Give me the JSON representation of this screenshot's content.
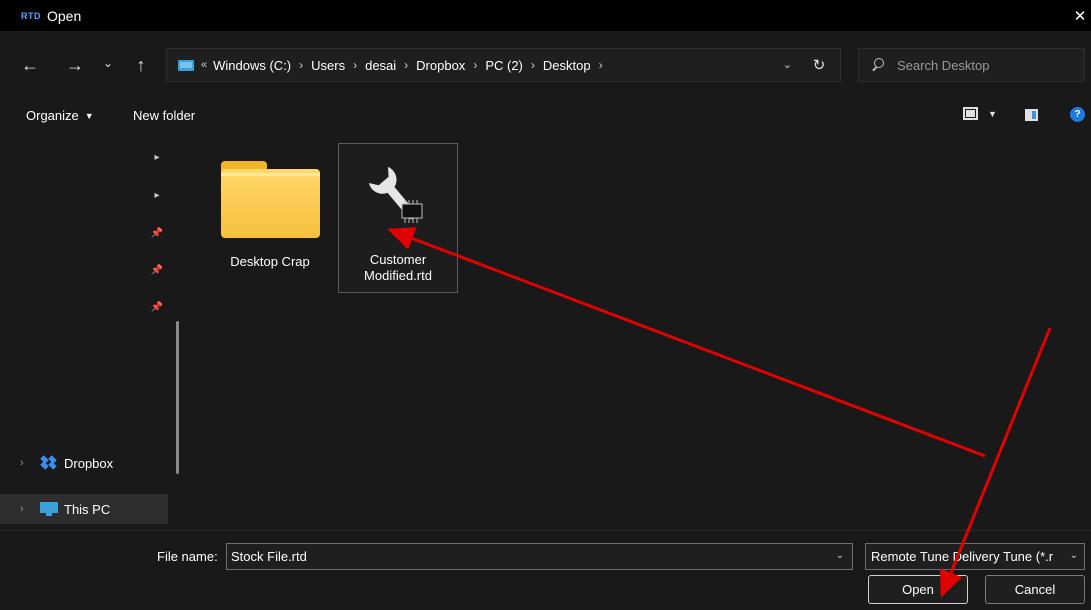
{
  "window": {
    "app_logo": "RTD",
    "title": "Open",
    "close_glyph": "✕"
  },
  "nav": {
    "back_glyph": "←",
    "forward_glyph": "→",
    "recent_glyph": "⌄",
    "up_glyph": "↑",
    "overflow_glyph": "«",
    "breadcrumb": [
      "Windows (C:)",
      "Users",
      "desai",
      "Dropbox",
      "PC (2)",
      "Desktop"
    ],
    "crumb_separator": "›",
    "dropdown_glyph": "⌄",
    "refresh_glyph": "↻",
    "search_placeholder": "Search Desktop"
  },
  "toolbar": {
    "organize_label": "Organize",
    "organize_caret": "▼",
    "new_folder_label": "New folder",
    "view_caret": "▼",
    "help_glyph": "?"
  },
  "sidebar": {
    "pins": [
      "▸",
      "▸",
      "📌",
      "📌",
      "📌"
    ],
    "items": [
      {
        "label": "Dropbox",
        "expand": "›",
        "icon": "dropbox-icon"
      },
      {
        "label": "This PC",
        "expand": "›",
        "icon": "pc-icon"
      }
    ]
  },
  "files": [
    {
      "name": "Desktop Crap",
      "icon": "folder-icon",
      "selected": false
    },
    {
      "name": "Customer Modified.rtd",
      "line1": "Customer",
      "line2": "Modified.rtd",
      "icon": "tune-file-icon",
      "selected": true
    }
  ],
  "bottom": {
    "file_name_label": "File name:",
    "file_name_value": "Stock File.rtd",
    "file_name_caret": "⌄",
    "filter_value": "Remote Tune Delivery Tune (*.r",
    "filter_caret": "⌄",
    "open_label": "Open",
    "cancel_label": "Cancel"
  },
  "colors": {
    "background": "#191919",
    "titlebar": "#000000",
    "annotation_arrow": "#e00000",
    "folder": "#f6c03d",
    "accent": "#1f7ae0"
  }
}
